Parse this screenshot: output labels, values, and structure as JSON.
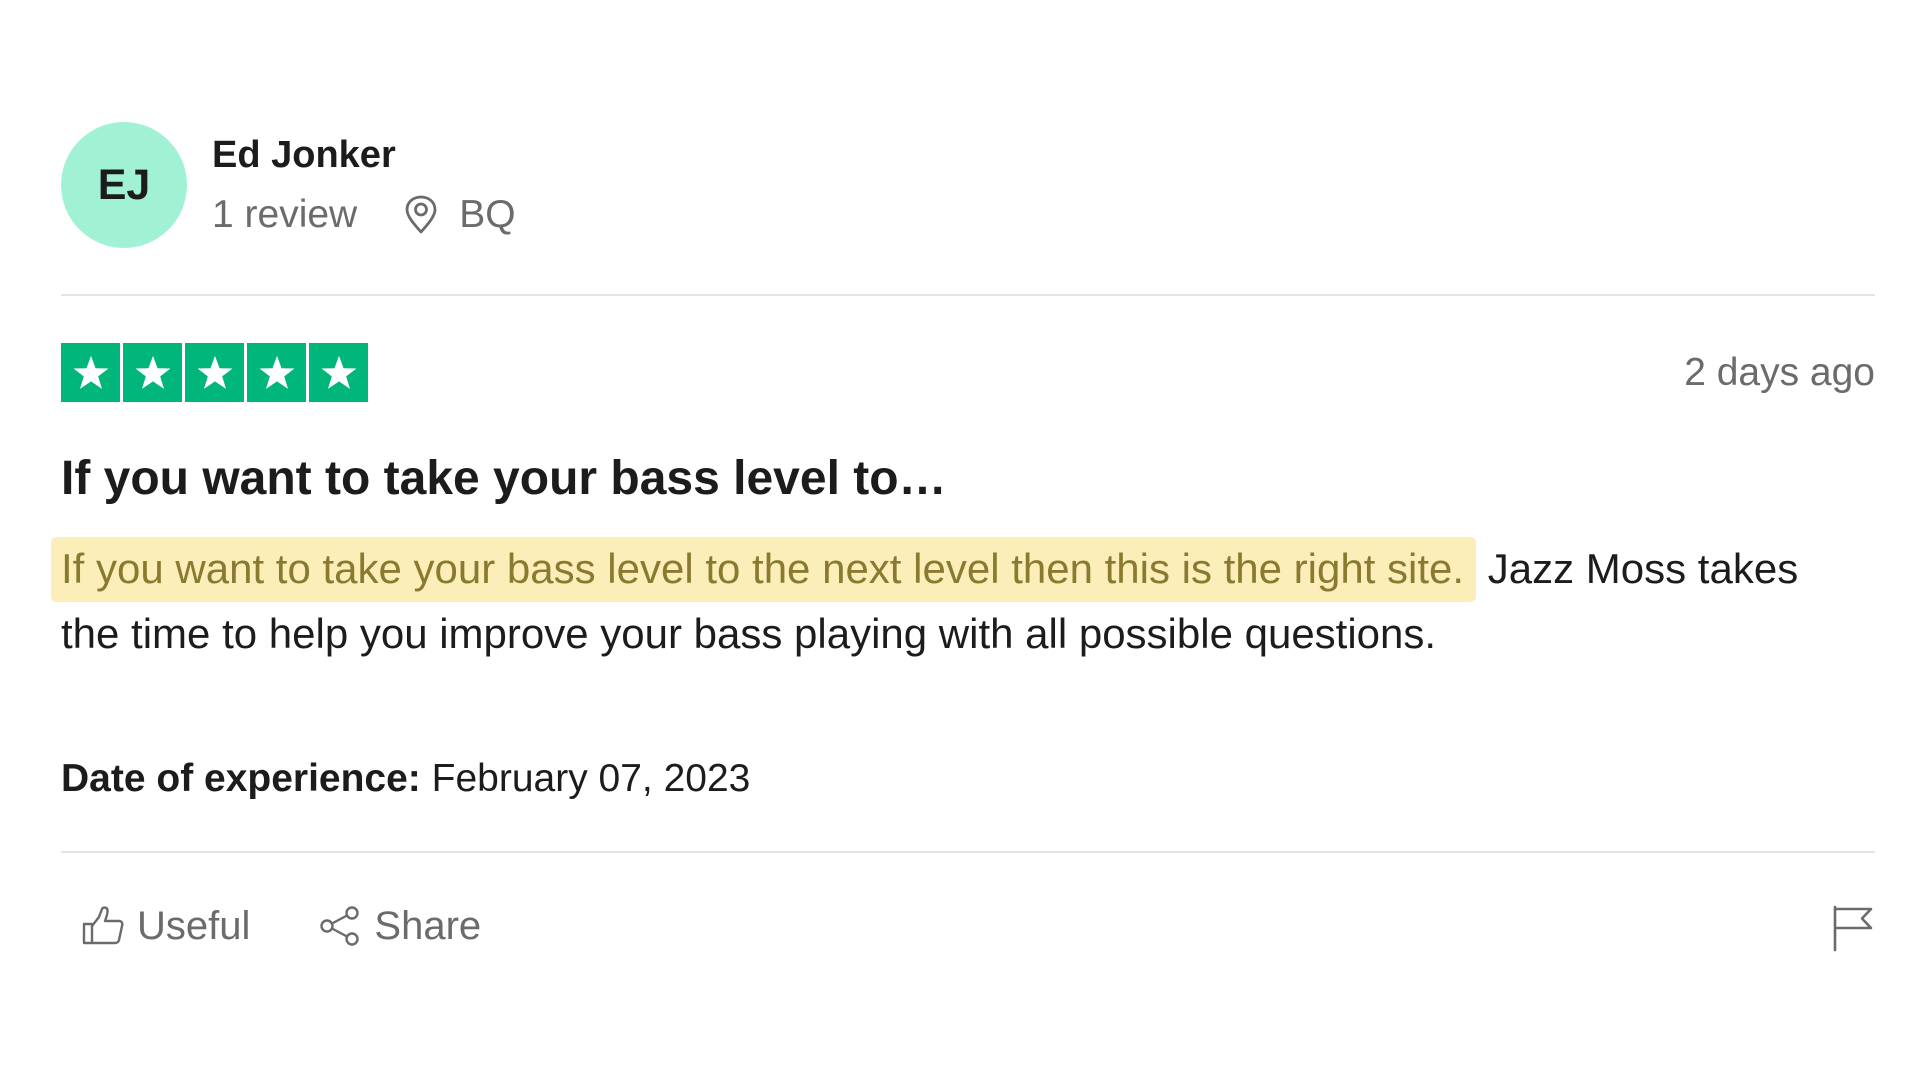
{
  "reviewer": {
    "initials": "EJ",
    "name": "Ed Jonker",
    "review_count": "1 review",
    "location": "BQ",
    "avatar_color": "#a1f2d4"
  },
  "review": {
    "rating": 5,
    "rating_max": 5,
    "star_color": "#00b67a",
    "posted": "2 days ago",
    "title": "If you want to take your bass level to…",
    "body_highlighted": "If you want to take your bass level to the next level then this is the right site.",
    "body_rest": " Jazz Moss takes the time to help you improve your bass playing with all possible questions.",
    "highlight_color": "#fbeeb8",
    "experience_label": "Date of experience:",
    "experience_date": " February 07, 2023"
  },
  "actions": {
    "useful_label": "Useful",
    "useful_icon": "thumbs-up-icon",
    "share_label": "Share",
    "share_icon": "share-icon",
    "report_icon": "flag-icon"
  }
}
